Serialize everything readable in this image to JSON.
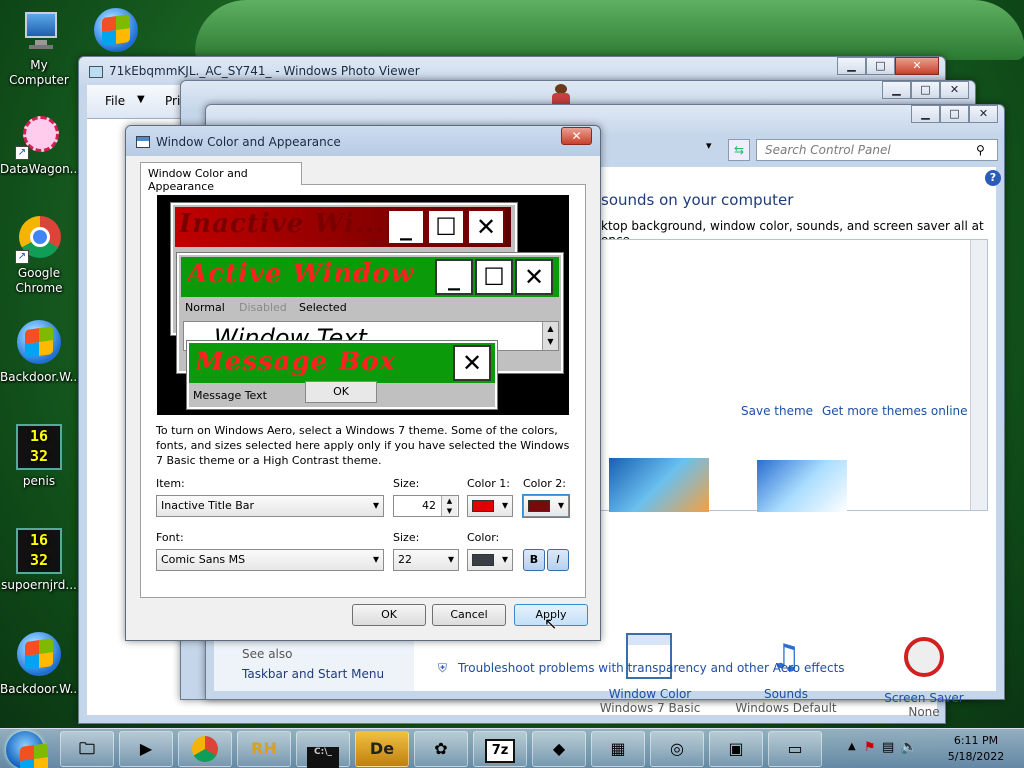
{
  "desktop": {
    "icons": [
      {
        "label": "My Computer"
      },
      {
        "label": "DataWagon..."
      },
      {
        "label": "Google Chrome"
      },
      {
        "label": "Backdoor.W..."
      },
      {
        "label": "penis"
      },
      {
        "label": "supoernjrd..."
      },
      {
        "label": "Backdoor.W..."
      }
    ],
    "clock_icon_digits": [
      "16",
      "32"
    ]
  },
  "photo_viewer": {
    "title": "71kEbqmmKJL._AC_SY741_ - Windows Photo Viewer",
    "menu": {
      "file": "File",
      "print": "Print"
    }
  },
  "control_panel": {
    "search_placeholder": "Search Control Panel",
    "heading": "sounds on your computer",
    "subheading": "ktop background, window color, sounds, and screen saver all at once.",
    "save_theme": "Save theme",
    "get_more": "Get more themes online",
    "window_color": {
      "label": "Window Color",
      "sub": "Windows 7 Basic"
    },
    "sounds": {
      "label": "Sounds",
      "sub": "Windows Default"
    },
    "screen_saver": {
      "label": "Screen Saver",
      "sub": "None"
    },
    "see_also": "See also",
    "taskbar_link": "Taskbar and Start Menu",
    "troubleshoot": "Troubleshoot problems with transparency and other Aero effects"
  },
  "dialog": {
    "title": "Window Color and Appearance",
    "tab": "Window Color and Appearance",
    "preview": {
      "inactive_title": "Inactive Wi...",
      "active_title": "Active Window",
      "menu_normal": "Normal",
      "menu_disabled": "Disabled",
      "menu_selected": "Selected",
      "window_text": "Window Text",
      "message_title": "Message Box",
      "message_text": "Message Text",
      "ok": "OK"
    },
    "description": "To turn on Windows Aero, select a Windows 7 theme.  Some of the colors, fonts, and sizes selected here apply only if you have selected the Windows 7 Basic theme or a High Contrast theme.",
    "item_label": "Item:",
    "item_value": "Inactive Title Bar",
    "size_label": "Size:",
    "size_value": "42",
    "color1_label": "Color 1:",
    "color2_label": "Color 2:",
    "font_label": "Font:",
    "font_value": "Comic Sans MS",
    "font_size_label": "Size:",
    "font_size_value": "22",
    "color_label": "Color:",
    "bold": "B",
    "italic": "I",
    "ok": "OK",
    "cancel": "Cancel",
    "apply": "Apply",
    "colors": {
      "color1": "#e00000",
      "color2": "#7a0a0a",
      "font_color": "#3a3f47",
      "active_bar": "#0a9a0a",
      "title_text": "#ff2020",
      "inactive_bar": "#c00000"
    }
  },
  "taskbar": {
    "clock_time": "6:11 PM",
    "clock_date": "5/18/2022",
    "items": [
      "explorer",
      "media-player",
      "chrome",
      "RH",
      "cmd",
      "De",
      "puzzle",
      "7z",
      "wolf",
      "control-panel",
      "network",
      "photo-viewer",
      "monitor"
    ]
  }
}
